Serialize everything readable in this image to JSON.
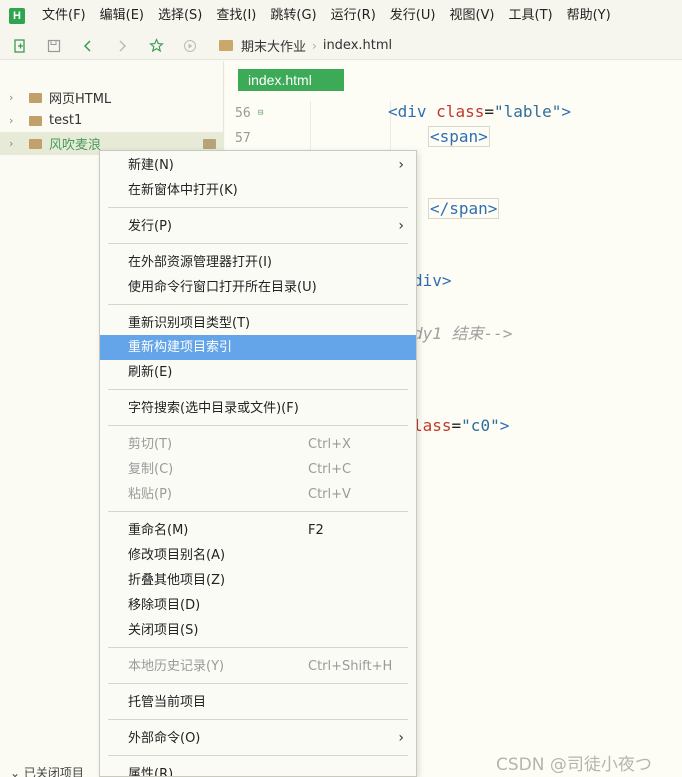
{
  "app": {
    "logo_letter": "H",
    "accent": "#2ea44f"
  },
  "menubar": [
    "文件(F)",
    "编辑(E)",
    "选择(S)",
    "查找(I)",
    "跳转(G)",
    "运行(R)",
    "发行(U)",
    "视图(V)",
    "工具(T)",
    "帮助(Y)"
  ],
  "toolbar": {
    "icons": [
      "new-file-icon",
      "save-icon",
      "back-icon",
      "forward-icon",
      "star-icon",
      "run-icon"
    ],
    "breadcrumb": [
      "期末大作业",
      "index.html"
    ]
  },
  "sidebar": {
    "items": [
      {
        "label": "网页HTML"
      },
      {
        "label": "test1"
      },
      {
        "label": "风吹麦浪"
      }
    ],
    "closed_label": "已关闭项目"
  },
  "editor": {
    "tab": "index.html",
    "line_numbers": [
      "56",
      "57"
    ],
    "code": {
      "line56_tag": "<div",
      "line56_attr": "class",
      "line56_eq": "=",
      "line56_val": "\"lable\"",
      "line56_close": ">",
      "line57": "<span>",
      "line_span_close": "</span>",
      "line_div_close": "div>",
      "line_comment": "dy1 结束-->",
      "line_class_attr": "lass",
      "line_class_eq": "=",
      "line_class_val": "\"c0\"",
      "line_class_close": ">"
    }
  },
  "context_menu": {
    "highlight_color": "#63a5e8",
    "items": [
      {
        "label": "新建(N)",
        "submenu": "›"
      },
      {
        "label": "在新窗体中打开(K)"
      },
      {
        "label": "发行(P)",
        "submenu": "›"
      },
      {
        "label": "在外部资源管理器打开(I)"
      },
      {
        "label": "使用命令行窗口打开所在目录(U)"
      },
      {
        "label": "重新识别项目类型(T)"
      },
      {
        "label": "重新构建项目索引"
      },
      {
        "label": "刷新(E)"
      },
      {
        "label": "字符搜索(选中目录或文件)(F)"
      },
      {
        "label": "剪切(T)",
        "shortcut": "Ctrl+X"
      },
      {
        "label": "复制(C)",
        "shortcut": "Ctrl+C"
      },
      {
        "label": "粘贴(P)",
        "shortcut": "Ctrl+V"
      },
      {
        "label": "重命名(M)",
        "shortcut": "F2"
      },
      {
        "label": "修改项目别名(A)"
      },
      {
        "label": "折叠其他项目(Z)"
      },
      {
        "label": "移除项目(D)"
      },
      {
        "label": "关闭项目(S)"
      },
      {
        "label": "本地历史记录(Y)",
        "shortcut": "Ctrl+Shift+H"
      },
      {
        "label": "托管当前项目"
      },
      {
        "label": "外部命令(O)",
        "submenu": "›"
      },
      {
        "label": "属性(R)"
      }
    ]
  },
  "watermark": "CSDN @司徒小夜つ"
}
